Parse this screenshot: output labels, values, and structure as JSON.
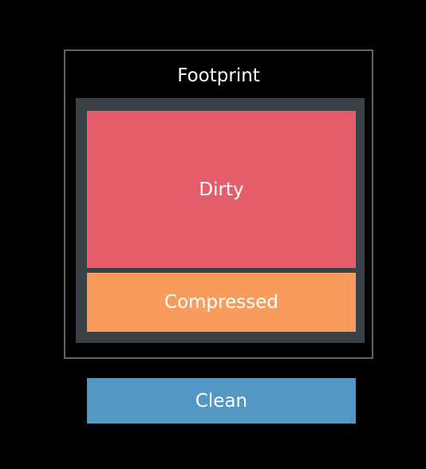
{
  "footprint": {
    "title": "Footprint",
    "border_color": "#5d666d",
    "frame_color": "#3b4247"
  },
  "segments": {
    "dirty": {
      "label": "Dirty",
      "color": "#e35d6a"
    },
    "compressed": {
      "label": "Compressed",
      "color": "#f89b5c"
    }
  },
  "clean": {
    "label": "Clean",
    "color": "#5497c4"
  }
}
